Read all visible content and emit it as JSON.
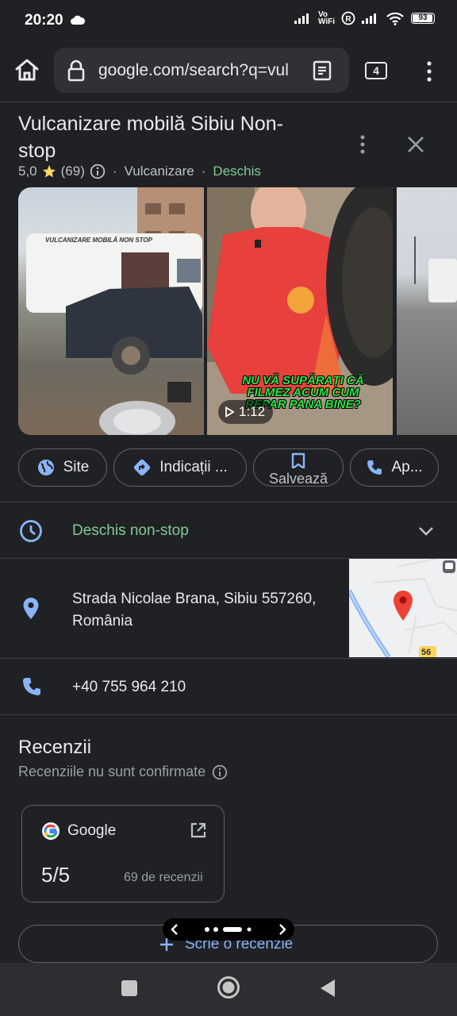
{
  "status": {
    "time": "20:20",
    "volte": "Vo\nWiFi",
    "battery": "93"
  },
  "browser": {
    "url": "google.com/search?q=vul",
    "tab_count": "4"
  },
  "place": {
    "title": "Vulcanizare mobilă Sibiu Non-stop",
    "rating": "5,0",
    "review_count": "(69)",
    "category": "Vulcanizare",
    "open_status": "Deschis",
    "photos": {
      "sign_text": "VULCANIZARE MOBILĂ NON STOP",
      "video_duration": "1:12",
      "video_caption": "NU VĂ SUPĂRAȚI CĂ FILMEZ ACUM CUM REPAR PANA BINE?"
    }
  },
  "actions": {
    "site": "Site",
    "directions": "Indicații ...",
    "save": "Salvează",
    "call": "Ap..."
  },
  "details": {
    "hours": "Deschis non-stop",
    "address": "Strada Nicolae Brana, Sibiu 557260, România",
    "phone": "+40 755 964 210",
    "map_road_label": "56"
  },
  "reviews": {
    "title": "Recenzii",
    "subtitle": "Recenziile nu sunt confirmate",
    "source": "Google",
    "score": "5/5",
    "count_label": "69 de recenzii",
    "write_label": "Scrie o recenzie"
  },
  "colors": {
    "accent": "#8ab4f8",
    "open": "#81c995",
    "star": "#fdd663",
    "pin": "#ea4335"
  }
}
